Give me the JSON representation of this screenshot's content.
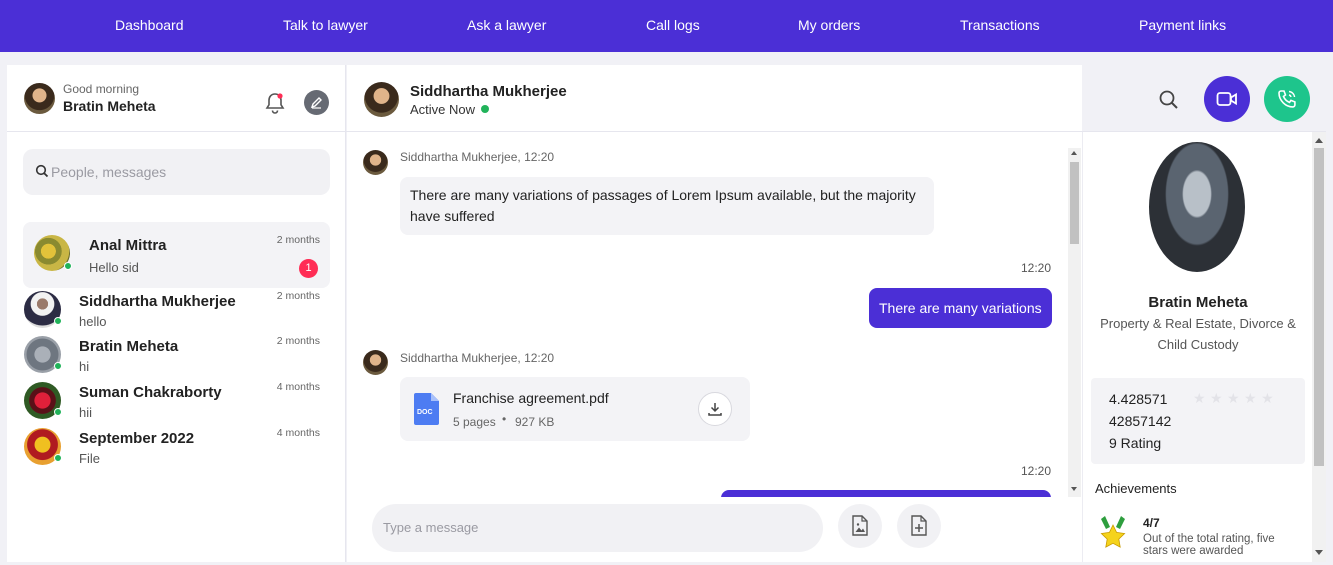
{
  "nav": [
    "Dashboard",
    "Talk to lawyer",
    "Ask a lawyer",
    "Call logs",
    "My orders",
    "Transactions",
    "Payment links"
  ],
  "profile": {
    "greeting": "Good morning",
    "name": "Bratin Meheta"
  },
  "search": {
    "placeholder": "People, messages"
  },
  "conversations": [
    {
      "name": "Anal Mittra",
      "preview": "Hello sid",
      "time": "2 months",
      "unread": "1"
    },
    {
      "name": "Siddhartha Mukherjee",
      "preview": "hello",
      "time": "2 months"
    },
    {
      "name": "Bratin Meheta",
      "preview": "hi",
      "time": "2 months"
    },
    {
      "name": "Suman Chakraborty",
      "preview": "hii",
      "time": "4 months"
    },
    {
      "name": "September 2022",
      "preview": "File",
      "time": "4 months"
    }
  ],
  "chat": {
    "contact_name": "Siddhartha Mukherjee",
    "status": "Active Now",
    "messages": [
      {
        "sender": "Siddhartha Mukherjee, 12:20",
        "text": "There are many variations of passages of Lorem Ipsum available, but the majority have suffered"
      },
      {
        "time": "12:20",
        "text": "There are many variations"
      },
      {
        "sender": "Siddhartha Mukherjee, 12:20",
        "file": {
          "name": "Franchise agreement.pdf",
          "pages": "5 pages",
          "size": "927 KB",
          "type_label": "DOC"
        }
      },
      {
        "time": "12:20"
      }
    ],
    "input_placeholder": "Type a message"
  },
  "lawyer": {
    "name": "Bratin Meheta",
    "specialty": "Property & Real Estate, Divorce & Child Custody",
    "rating_line1": "4.428571",
    "rating_line2": "42857142",
    "rating_count": "9 Rating",
    "stars_filled": 0,
    "achievements_title": "Achievements",
    "achievement": {
      "value": "4/7",
      "desc": "Out of the total rating, five stars were awarded"
    }
  },
  "colors": {
    "brand": "#4b2fd6",
    "call": "#1ec58c",
    "online": "#21b35a",
    "badge": "#ff2d55"
  }
}
